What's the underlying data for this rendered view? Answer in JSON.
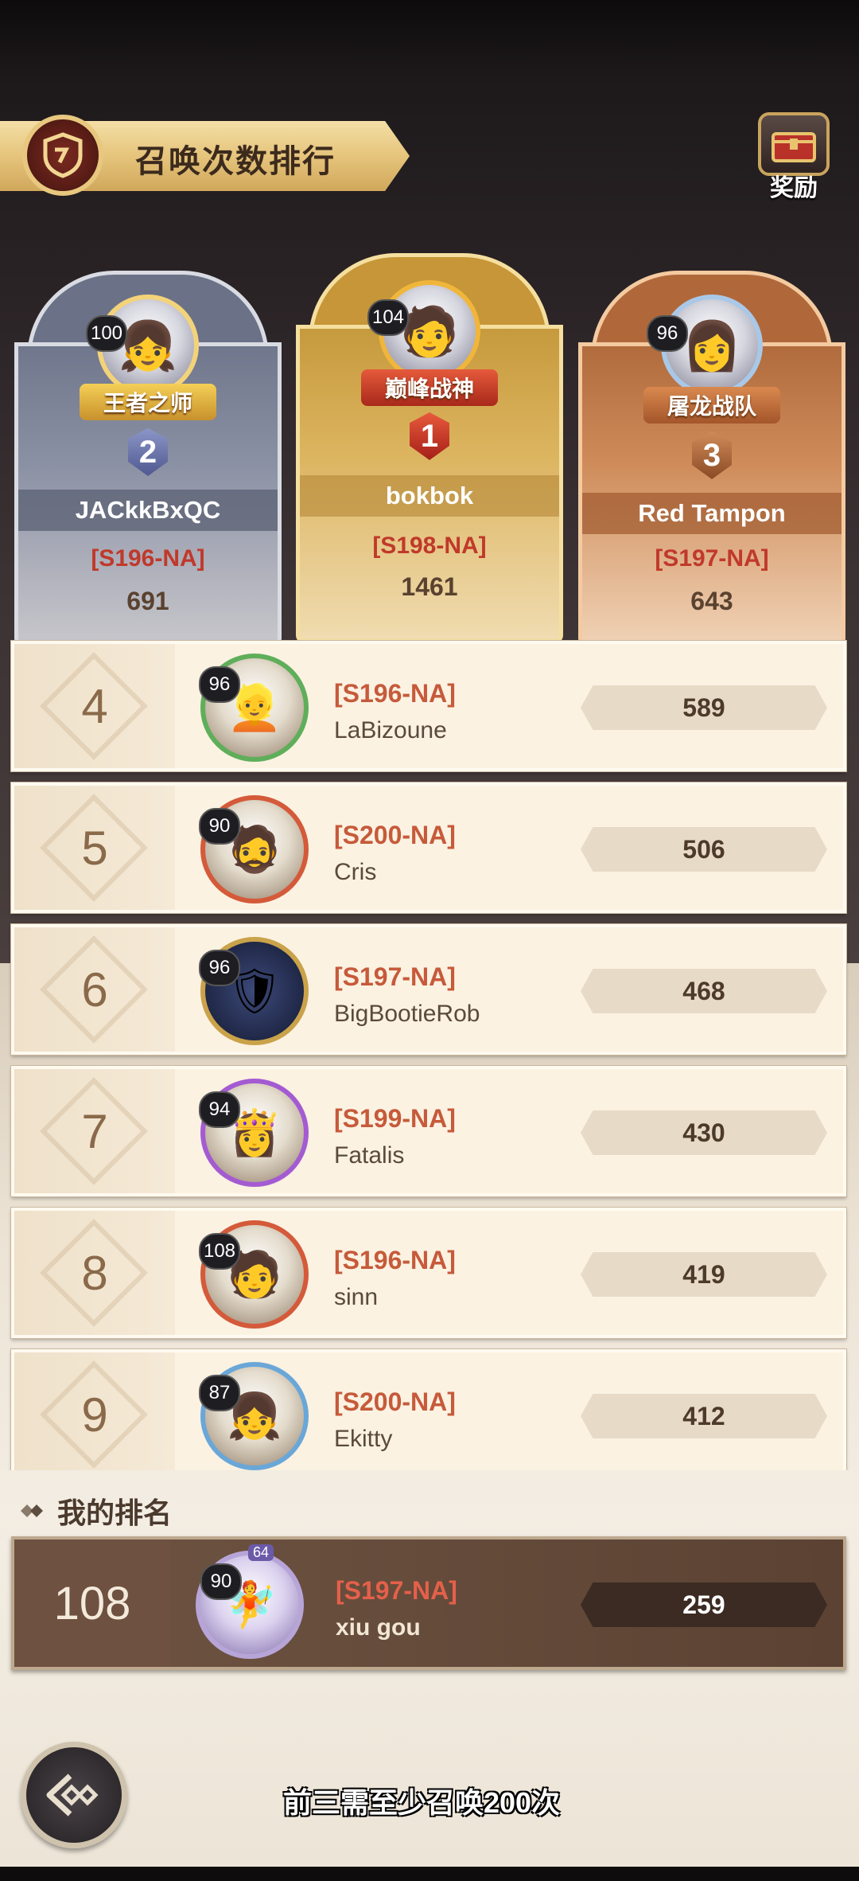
{
  "header": {
    "title": "召唤次数排行",
    "reward_label": "奖励"
  },
  "podium": [
    {
      "rank": "2",
      "level": "100",
      "title_badge": "王者之师",
      "name": "JACkkBxQC",
      "server": "[S196-NA]",
      "count": "691"
    },
    {
      "rank": "1",
      "level": "104",
      "title_badge": "巅峰战神",
      "name": "bokbok",
      "server": "[S198-NA]",
      "count": "1461"
    },
    {
      "rank": "3",
      "level": "96",
      "title_badge": "屠龙战队",
      "name": "Red Tampon",
      "server": "[S197-NA]",
      "count": "643"
    }
  ],
  "rows": [
    {
      "rank": "4",
      "level": "96",
      "server": "[S196-NA]",
      "name": "LaBizoune",
      "score": "589"
    },
    {
      "rank": "5",
      "level": "90",
      "server": "[S200-NA]",
      "name": "Cris",
      "score": "506"
    },
    {
      "rank": "6",
      "level": "96",
      "server": "[S197-NA]",
      "name": "BigBootieRob",
      "score": "468"
    },
    {
      "rank": "7",
      "level": "94",
      "server": "[S199-NA]",
      "name": "Fatalis",
      "score": "430"
    },
    {
      "rank": "8",
      "level": "108",
      "server": "[S196-NA]",
      "name": "sinn",
      "score": "419"
    },
    {
      "rank": "9",
      "level": "87",
      "server": "[S200-NA]",
      "name": "Ekitty",
      "score": "412"
    }
  ],
  "my_rank": {
    "label": "我的排名",
    "rank": "108",
    "level": "90",
    "frame_level": "64",
    "server": "[S197-NA]",
    "name": "xiu gou",
    "score": "259"
  },
  "footnote": "前三需至少召唤200次",
  "icons": {
    "title_emblem": "shield-emblem-icon",
    "reward": "treasure-chest-icon",
    "back": "back-arrow-icon",
    "my_rank_marker": "diamond-icon"
  }
}
